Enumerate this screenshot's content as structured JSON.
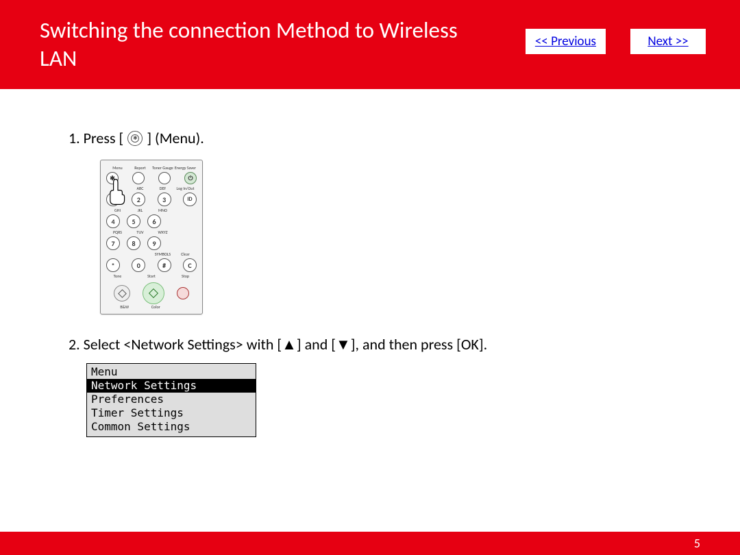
{
  "header": {
    "title": "Switching the connection Method to Wireless LAN",
    "prev_label": "<< Previous",
    "next_label": "Next >>"
  },
  "steps": {
    "s1_prefix": "1. Press [",
    "s1_suffix": "] (Menu).",
    "s2": "2. Select <Network Settings> with [▲] and [▼], and then press [OK]."
  },
  "keypad": {
    "top_labels": [
      "Menu",
      "Report",
      "Toner Gauge",
      "Energy Saver"
    ],
    "row2_labels": [
      "",
      "ABC",
      "DEF",
      "Log In/Out"
    ],
    "row2": [
      "",
      "2",
      "3",
      "ID"
    ],
    "row3_labels": [
      "",
      "JKL",
      "MNO",
      ""
    ],
    "row3": [
      "4",
      "5",
      "6"
    ],
    "row4_labels": [
      "PQRS",
      "TUV",
      "WXYZ",
      ""
    ],
    "row4": [
      "7",
      "8",
      "9"
    ],
    "row5_labels": [
      "",
      "",
      "SYMBOLS",
      "Clear"
    ],
    "row5": [
      "*",
      "0",
      "#",
      "C"
    ],
    "tone_label": "Tone",
    "start_label": "Start",
    "stop_label": "Stop",
    "bw_label": "B&W",
    "color_label": "Color"
  },
  "lcd": {
    "title": "Menu",
    "items": [
      "Network Settings",
      "Preferences",
      "Timer Settings",
      "Common Settings"
    ],
    "selected_index": 0
  },
  "footer": {
    "page_number": "5"
  }
}
